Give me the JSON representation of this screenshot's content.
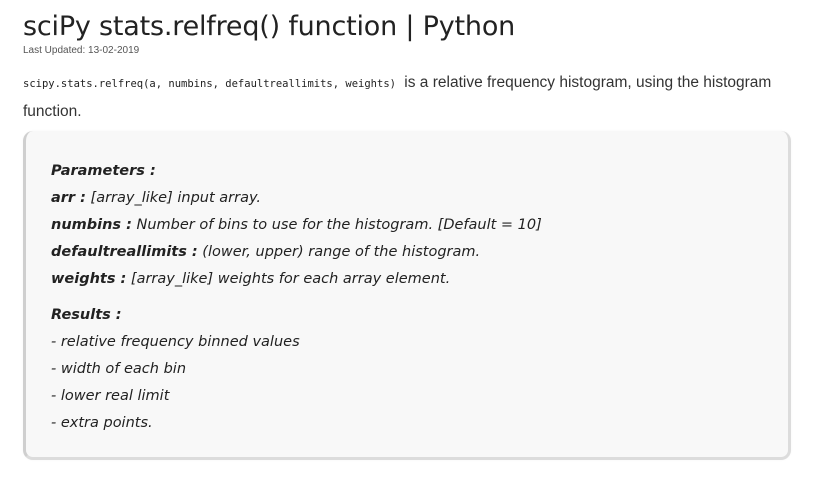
{
  "article": {
    "title": "sciPy stats.relfreq() function | Python",
    "last_updated": "Last Updated: 13-02-2019",
    "intro": {
      "code": "scipy.stats.relfreq(a, numbins, defaultreallimits, weights)",
      "text": " is a relative frequency histogram, using the histogram function."
    }
  },
  "params_box": {
    "parameters_heading": "Parameters :",
    "params": [
      {
        "name": "arr :",
        "desc": " [array_like] input array."
      },
      {
        "name": "numbins :",
        "desc": " Number of bins to use for the histogram. [Default = 10]"
      },
      {
        "name": "defaultreallimits :",
        "desc": " (lower, upper) range of the histogram."
      },
      {
        "name": "weights :",
        "desc": " [array_like] weights for each array element."
      }
    ],
    "results_heading": "Results :",
    "results": [
      "- relative frequency binned values",
      "- width of each bin",
      "- lower real limit",
      "- extra points."
    ]
  }
}
